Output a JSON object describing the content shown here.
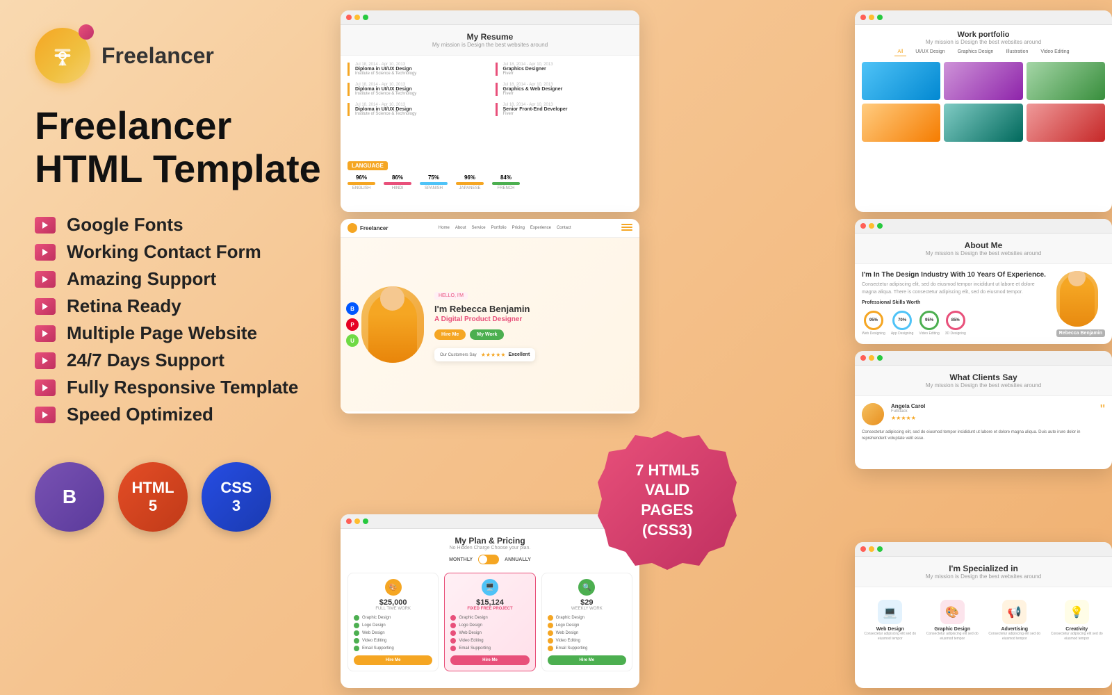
{
  "brand": {
    "logo_text": "Freelancer",
    "main_title_line1": "Freelancer",
    "main_title_line2": "HTML Template"
  },
  "features": [
    {
      "id": "google-fonts",
      "label": "Google Fonts"
    },
    {
      "id": "working-contact",
      "label": "Working Contact Form"
    },
    {
      "id": "amazing-support",
      "label": "Amazing Support"
    },
    {
      "id": "retina-ready",
      "label": "Retina Ready"
    },
    {
      "id": "multiple-page",
      "label": "Multiple Page Website"
    },
    {
      "id": "247-support",
      "label": "24/7 Days Support"
    },
    {
      "id": "responsive",
      "label": "Fully Responsive Template"
    },
    {
      "id": "speed",
      "label": "Speed Optimized"
    }
  ],
  "tech_badges": [
    {
      "id": "bootstrap",
      "symbol": "B",
      "label": "Bootstrap"
    },
    {
      "id": "html5",
      "symbol": "5",
      "label": "HTML5"
    },
    {
      "id": "css3",
      "symbol": "3",
      "label": "CSS3"
    }
  ],
  "stamp": {
    "line1": "7 HTML5",
    "line2": "VALID PAGES",
    "line3": "(CSS3)"
  },
  "screenshots": {
    "resume": {
      "title": "My Resume",
      "subtitle": "My mission is Design the best websites around",
      "langs": [
        "96% ENGLISH",
        "86% HINDI",
        "75% SPANISH",
        "96% JAPANESE",
        "84% FRENCH"
      ]
    },
    "portfolio": {
      "title": "Work portfolio",
      "subtitle": "My mission is Design the best websites around",
      "tabs": [
        "All",
        "UI/UX Design",
        "Graphics Design",
        "Illustration",
        "Video Editing"
      ]
    },
    "hero": {
      "logo": "Freelancer",
      "nav": [
        "Home",
        "About",
        "Service",
        "Portfolio",
        "Pricing",
        "Experience",
        "Contact"
      ],
      "tag": "HELLO, I'M",
      "name": "I'm Rebecca Benjamin",
      "role_prefix": "A",
      "role": "Digital Product Designer",
      "btn1": "Hire Me",
      "btn2": "My Work",
      "testimonial_label": "Our Customers Say",
      "rating": "Excellent"
    },
    "about": {
      "title": "About Me",
      "subtitle": "My mission is Design the best websites around",
      "heading": "I'm In The Design Industry With 10 Years Of Experience.",
      "section": "Professional Skills Worth",
      "skills": [
        "95%",
        "70%",
        "95%",
        "85%"
      ],
      "skill_labels": [
        "Web Designing",
        "App Designing",
        "Video Editing",
        "3D Designing"
      ],
      "name": "Rebecca Benjamin"
    },
    "pricing": {
      "title": "My Plan & Pricing",
      "subtitle": "No Hidden Charge Choose your plan.",
      "toggle": [
        "MONTHLY",
        "ANNUALLY"
      ],
      "plans": [
        {
          "price": "$25,000",
          "type": "FULL TIME WORK",
          "features": [
            "Graphic Design",
            "Logo Design",
            "Web Design",
            "Video Editing",
            "Email Supporting"
          ],
          "btn": "Hire Me",
          "color": "orange"
        },
        {
          "price": "$15,124",
          "type": "FIXED FREE PROJECT",
          "features": [
            "Graphic Design",
            "Logo Design",
            "Web Design",
            "Video Editing",
            "Email Supporting"
          ],
          "btn": "Hire Me",
          "color": "pink",
          "featured": true
        },
        {
          "price": "$29",
          "type": "WEEKLY WORK",
          "features": [
            "Graphic Design",
            "Logo Design",
            "Web Design",
            "Video Editing",
            "Email Supporting"
          ],
          "btn": "Hire Me",
          "color": "green"
        }
      ]
    },
    "testimonials": {
      "title": "What Clients Say",
      "subtitle": "My mission is Design the best websites around",
      "name": "Angela Carol",
      "role": "Fullstack",
      "stars": "★★★★★",
      "text": "Consectetur adipiscing elit, sed do eiusmod tempor incididunt ut labore et dolore magna aliqua. Duis aute irure dolor in reprehenderit voluptate velit esse."
    },
    "specialized": {
      "title": "I'm Specialized in",
      "subtitle": "My mission is Design the best websites around",
      "items": [
        {
          "name": "Web Design",
          "icon": "💻",
          "color": "blue"
        },
        {
          "name": "Graphic Design",
          "icon": "🎨",
          "color": "pink"
        },
        {
          "name": "Advertising",
          "icon": "📢",
          "color": "orange"
        },
        {
          "name": "Creativity",
          "icon": "💡",
          "color": "yellow"
        }
      ]
    }
  }
}
